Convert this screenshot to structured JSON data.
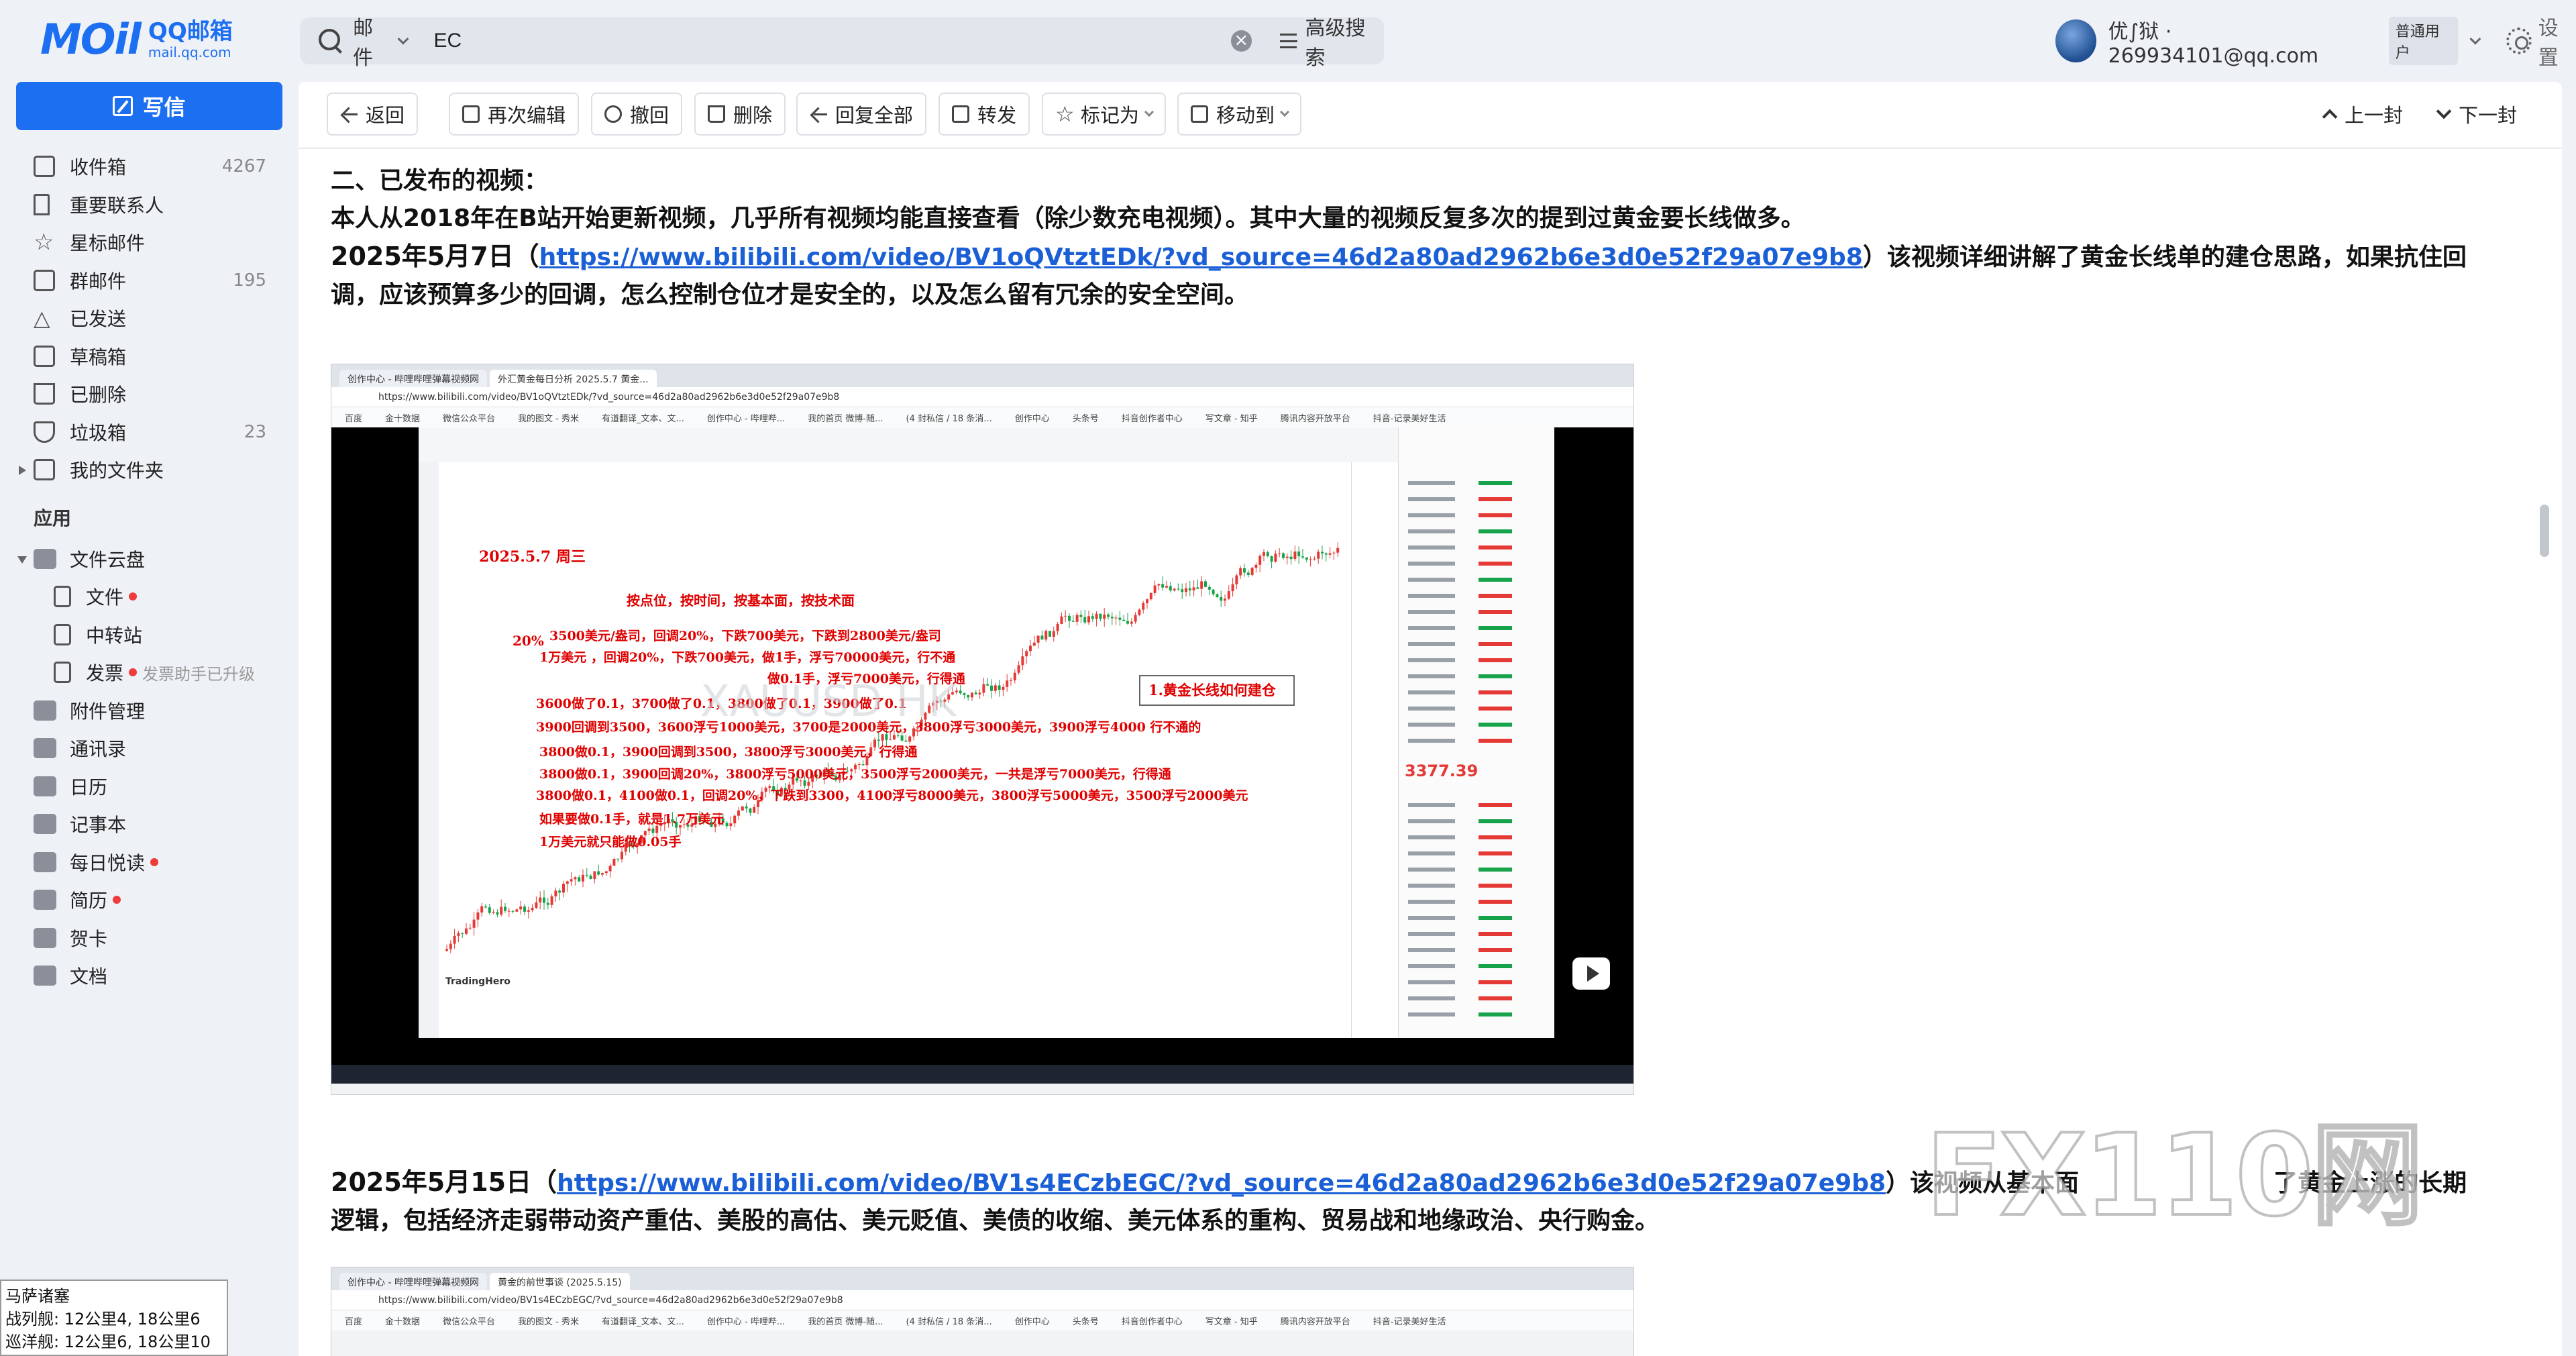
{
  "app": {
    "logo_mark": "MOil",
    "logo_cn": "QQ邮箱",
    "logo_url": "mail.qq.com",
    "brand_color": "#1d6ff2"
  },
  "search": {
    "scope": "邮件",
    "value": "EC",
    "advanced": "高级搜索"
  },
  "user": {
    "name": "优∫狱 · 269934101@qq.com",
    "badge": "普通用户",
    "settings": "设置"
  },
  "sidebar": {
    "compose": "写信",
    "items": [
      {
        "label": "收件箱",
        "count": "4267",
        "icon": "inbox-icon"
      },
      {
        "label": "重要联系人",
        "count": "",
        "icon": "bookmark-icon"
      },
      {
        "label": "星标邮件",
        "count": "",
        "icon": "star-icon"
      },
      {
        "label": "群邮件",
        "count": "195",
        "icon": "group-icon"
      },
      {
        "label": "已发送",
        "count": "",
        "icon": "sent-icon"
      },
      {
        "label": "草稿箱",
        "count": "",
        "icon": "draft-icon"
      },
      {
        "label": "已删除",
        "count": "",
        "icon": "trash-icon"
      },
      {
        "label": "垃圾箱",
        "count": "23",
        "icon": "shield-icon"
      },
      {
        "label": "我的文件夹",
        "count": "",
        "icon": "folder-icon"
      }
    ],
    "apps_heading": "应用",
    "cloud": {
      "label": "文件云盘",
      "icon": "cloud-drive-icon"
    },
    "cloud_children": [
      {
        "label": "文件",
        "icon": "file-icon",
        "dot": true,
        "hint": ""
      },
      {
        "label": "中转站",
        "icon": "transfer-icon",
        "dot": false,
        "hint": ""
      },
      {
        "label": "发票",
        "icon": "invoice-icon",
        "dot": true,
        "hint": "发票助手已升级"
      }
    ],
    "apps": [
      {
        "label": "附件管理",
        "icon": "attachment-icon",
        "dot": false
      },
      {
        "label": "通讯录",
        "icon": "contacts-icon",
        "dot": false
      },
      {
        "label": "日历",
        "icon": "calendar-icon",
        "dot": false
      },
      {
        "label": "记事本",
        "icon": "notepad-icon",
        "dot": false
      },
      {
        "label": "每日悦读",
        "icon": "reading-icon",
        "dot": true
      },
      {
        "label": "简历",
        "icon": "resume-icon",
        "dot": true
      },
      {
        "label": "贺卡",
        "icon": "card-icon",
        "dot": false
      },
      {
        "label": "文档",
        "icon": "docs-icon",
        "dot": false
      }
    ]
  },
  "overlay": {
    "title": "马萨诸塞",
    "line1": "战列舰: 12公里4, 18公里6",
    "line2": "巡洋舰: 12公里6, 18公里10"
  },
  "toolbar": {
    "back": "返回",
    "reedit": "再次编辑",
    "recall": "撤回",
    "delete": "删除",
    "reply_all": "回复全部",
    "forward": "转发",
    "mark_as": "标记为",
    "move_to": "移动到",
    "prev": "上一封",
    "next": "下一封"
  },
  "mail": {
    "heading": "二、已发布的视频：",
    "intro": "本人从2018年在B站开始更新视频，几乎所有视频均能直接查看（除少数充电视频）。其中大量的视频反复多次的提到过黄金要长线做多。",
    "p1_date": "2025年5月7日（",
    "p1_link": "https://www.bilibili.com/video/BV1oQVtztEDk/?vd_source=46d2a80ad2962b6e3d0e52f29a07e9b8",
    "p1_text": "）该视频详细讲解了黄金长线单的建仓思路，如果抗住回调，应该预算多少的回调，怎么控制仓位才是安全的，以及怎么留有冗余的安全空间。",
    "p2_date": "2025年5月15日（",
    "p2_link": "https://www.bilibili.com/video/BV1s4ECzbEGC/?vd_source=46d2a80ad2962b6e3d0e52f29a07e9b8",
    "p2_text_a": "）该视频从基本面",
    "p2_text_b": "了黄金上涨的长期",
    "p2_text_2": "逻辑，包括经济走弱带动资产重估、美股的高估、美元贬值、美债的收缩、美元体系的重构、贸易战和地缘政治、央行购金。"
  },
  "video1": {
    "tab1": "创作中心 - 哔哩哔哩弹幕视频网",
    "tab2": "外汇黄金每日分析 2025.5.7 黄金...",
    "url": "https://www.bilibili.com/video/BV1oQVtztEDk/?vd_source=46d2a80ad2962b6e3d0e52f29a07e9b8",
    "bookmarks": [
      "百度",
      "金十数据",
      "微信公众平台",
      "我的图文 - 秀米",
      "有道翻译_文本、文...",
      "创作中心 - 哔哩哔...",
      "我的首页 微博-随...",
      "(4 封私信 / 18 条消...",
      "创作中心",
      "头条号",
      "抖音创作者中心",
      "写文章 - 知乎",
      "腾讯内容开放平台",
      "抖音-记录美好生活"
    ],
    "chart_header": "2025.5.7 周三",
    "chart_subtitle": "按点位，按时间，按基本面，按技术面",
    "pct": "20%",
    "annotations": [
      "3500美元/盎司，回调20%，下跌700美元，下跌到2800美元/盎司",
      "1万美元 ，回调20%，下跌700美元，做1手，浮亏70000美元，行不通",
      "做0.1手，浮亏7000美元，行得通",
      "3600做了0.1，3700做了0.1，3800做了0.1，3900做了0.1",
      "3900回调到3500，3600浮亏1000美元，3700是2000美元，3800浮亏3000美元，3900浮亏4000 行不通的",
      "3800做0.1，3900回调到3500，3800浮亏3000美元，行得通",
      "3800做0.1，3900回调20%，3800浮亏5000美元，3500浮亏2000美元，一共是浮亏7000美元，行得通",
      "3800做0.1，4100做0.1，回调20%，下跌到3300，4100浮亏8000美元，3800浮亏5000美元，3500浮亏2000美元",
      "如果要做0.1手，就是1.7万美元",
      "1万美元就只能做0.05手"
    ],
    "callout": "1.黄金长线如何建仓",
    "watermark": "XAUUSD HK",
    "price": "3377.39",
    "brand": "TradingHero"
  },
  "video2": {
    "tab1": "创作中心 - 哔哩哔哩弹幕视频网",
    "tab2": "黄金的前世事谈 (2025.5.15)",
    "url": "https://www.bilibili.com/video/BV1s4ECzbEGC/?vd_source=46d2a80ad2962b6e3d0e52f29a07e9b8",
    "bookmarks": [
      "百度",
      "金十数据",
      "微信公众平台",
      "我的图文 - 秀米",
      "有道翻译_文本、文...",
      "创作中心 - 哔哩哔...",
      "我的首页 微博-随...",
      "(4 封私信 / 18 条消...",
      "创作中心",
      "头条号",
      "抖音创作者中心",
      "写文章 - 知乎",
      "腾讯内容开放平台",
      "抖音-记录美好生活"
    ]
  },
  "watermark_text": "FX110网",
  "colors": {
    "link": "#1a5fd6",
    "candle_up": "#e53935",
    "candle_down": "#17a34a",
    "annotation": "#e00000"
  }
}
